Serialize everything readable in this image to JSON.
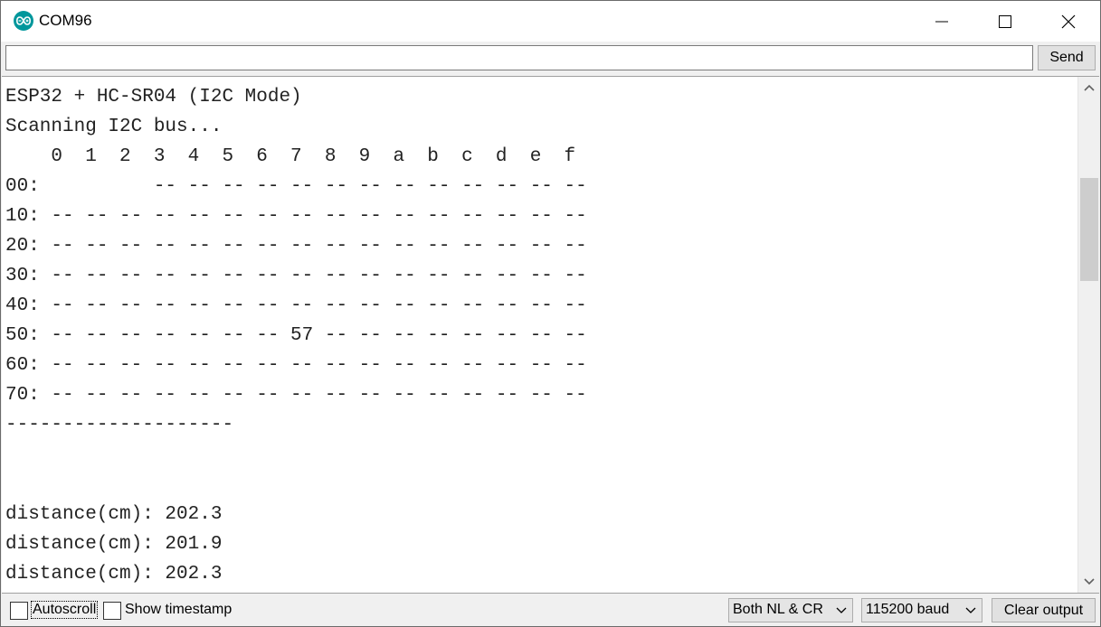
{
  "window": {
    "title": "COM96"
  },
  "toolbar": {
    "input_value": "",
    "send_label": "Send"
  },
  "output": {
    "lines": [
      "ESP32 + HC-SR04 (I2C Mode)",
      "Scanning I2C bus...",
      "    0  1  2  3  4  5  6  7  8  9  a  b  c  d  e  f",
      "00:          -- -- -- -- -- -- -- -- -- -- -- -- --",
      "10: -- -- -- -- -- -- -- -- -- -- -- -- -- -- -- --",
      "20: -- -- -- -- -- -- -- -- -- -- -- -- -- -- -- --",
      "30: -- -- -- -- -- -- -- -- -- -- -- -- -- -- -- --",
      "40: -- -- -- -- -- -- -- -- -- -- -- -- -- -- -- --",
      "50: -- -- -- -- -- -- -- 57 -- -- -- -- -- -- -- --",
      "60: -- -- -- -- -- -- -- -- -- -- -- -- -- -- -- --",
      "70: -- -- -- -- -- -- -- -- -- -- -- -- -- -- -- --",
      "--------------------",
      "",
      "",
      "distance(cm): 202.3",
      "distance(cm): 201.9",
      "distance(cm): 202.3"
    ]
  },
  "statusbar": {
    "autoscroll_label": "Autoscroll",
    "autoscroll_checked": false,
    "timestamp_label": "Show timestamp",
    "timestamp_checked": false,
    "line_ending": "Both NL & CR",
    "baud_rate": "115200 baud",
    "clear_label": "Clear output"
  },
  "colors": {
    "arduino_teal": "#00979c",
    "window_bg": "#f0f0f0",
    "output_text": "#222222"
  }
}
